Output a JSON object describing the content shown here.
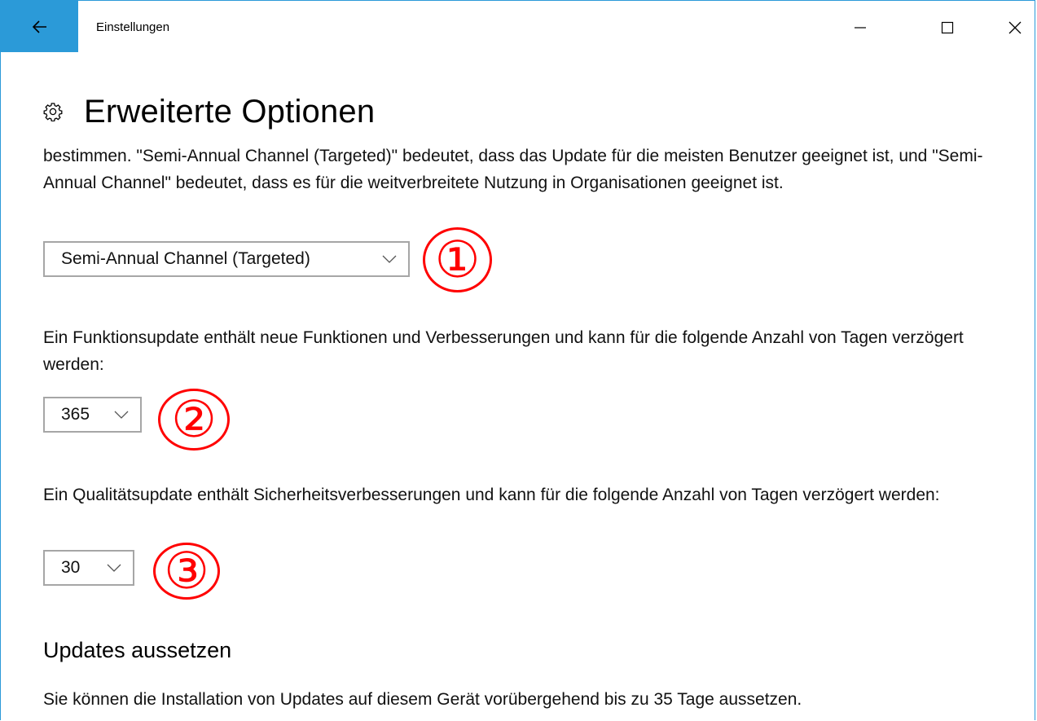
{
  "window": {
    "app_title": "Einstellungen",
    "accent_color": "#2b9ad8"
  },
  "icons": {
    "back": "back-arrow-icon",
    "minimize": "minimize-icon",
    "maximize": "maximize-icon",
    "close": "close-icon",
    "settings": "gear-icon",
    "chevron": "chevron-down-icon"
  },
  "page": {
    "title": "Erweiterte Optionen"
  },
  "branch": {
    "description": "bestimmen. \"Semi-Annual Channel (Targeted)\" bedeutet, dass das Update für die meisten Benutzer geeignet ist, und \"Semi-Annual Channel\" bedeutet, dass es für die weitverbreitete Nutzung in Organisationen geeignet ist.",
    "selected": "Semi-Annual Channel (Targeted)"
  },
  "feature_update": {
    "description": "Ein Funktionsupdate enthält neue Funktionen und Verbesserungen und kann für die folgende Anzahl von Tagen verzögert werden:",
    "selected": "365"
  },
  "quality_update": {
    "description": "Ein Qualitätsupdate enthält Sicherheitsverbesserungen und kann für die folgende Anzahl von Tagen verzögert werden:",
    "selected": "30"
  },
  "annotations": {
    "one": "①",
    "two": "②",
    "three": "③",
    "color": "#ff0000"
  },
  "pause": {
    "title": "Updates aussetzen",
    "description": "Sie können die Installation von Updates auf diesem Gerät vorübergehend bis zu 35 Tage aussetzen."
  }
}
